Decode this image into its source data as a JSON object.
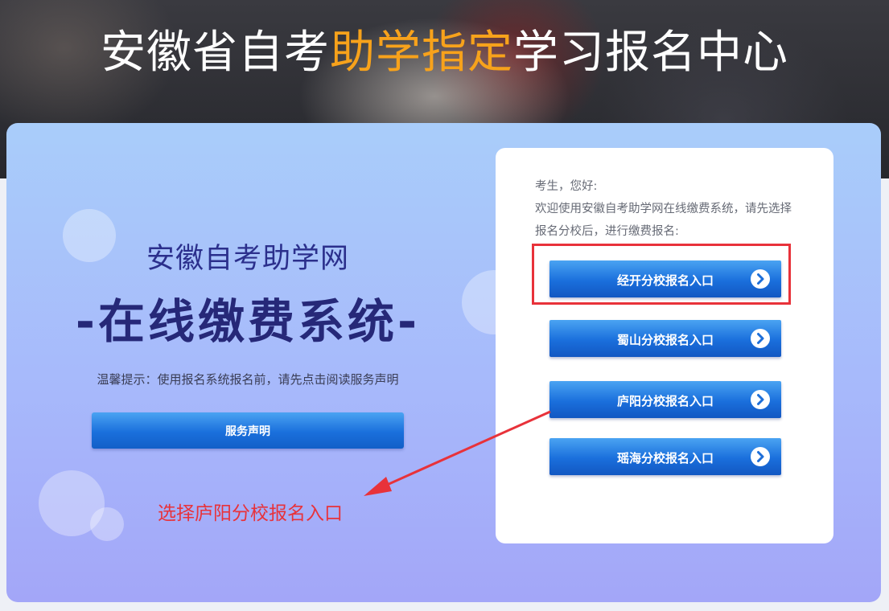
{
  "header": {
    "title_part1": "安徽省自考",
    "title_highlight": "助学指定",
    "title_part2": "学习报名中心"
  },
  "left": {
    "subtitle": "安徽自考助学网",
    "main_title": "-在线缴费系统-",
    "tip": "温馨提示：使用报名系统报名前，请先点击阅读服务声明",
    "statement_button": "服务声明"
  },
  "card": {
    "greeting_line1": "考生，您好:",
    "greeting_line2": "欢迎使用安徽自考助学网在线缴费系统，请先选择报名分校后，进行缴费报名:",
    "entries": [
      {
        "label": "经开分校报名入口",
        "icon": "chevron-right-circle-icon"
      },
      {
        "label": "蜀山分校报名入口",
        "icon": "chevron-right-circle-icon"
      },
      {
        "label": "庐阳分校报名入口",
        "icon": "chevron-right-circle-icon"
      },
      {
        "label": "瑶海分校报名入口",
        "icon": "chevron-right-circle-icon"
      }
    ]
  },
  "annotation": {
    "text": "选择庐阳分校报名入口",
    "color": "#e8323a"
  },
  "colors": {
    "accent": "#f7a21b",
    "button_blue": "#1a6fdc",
    "navy_title": "#262878"
  }
}
